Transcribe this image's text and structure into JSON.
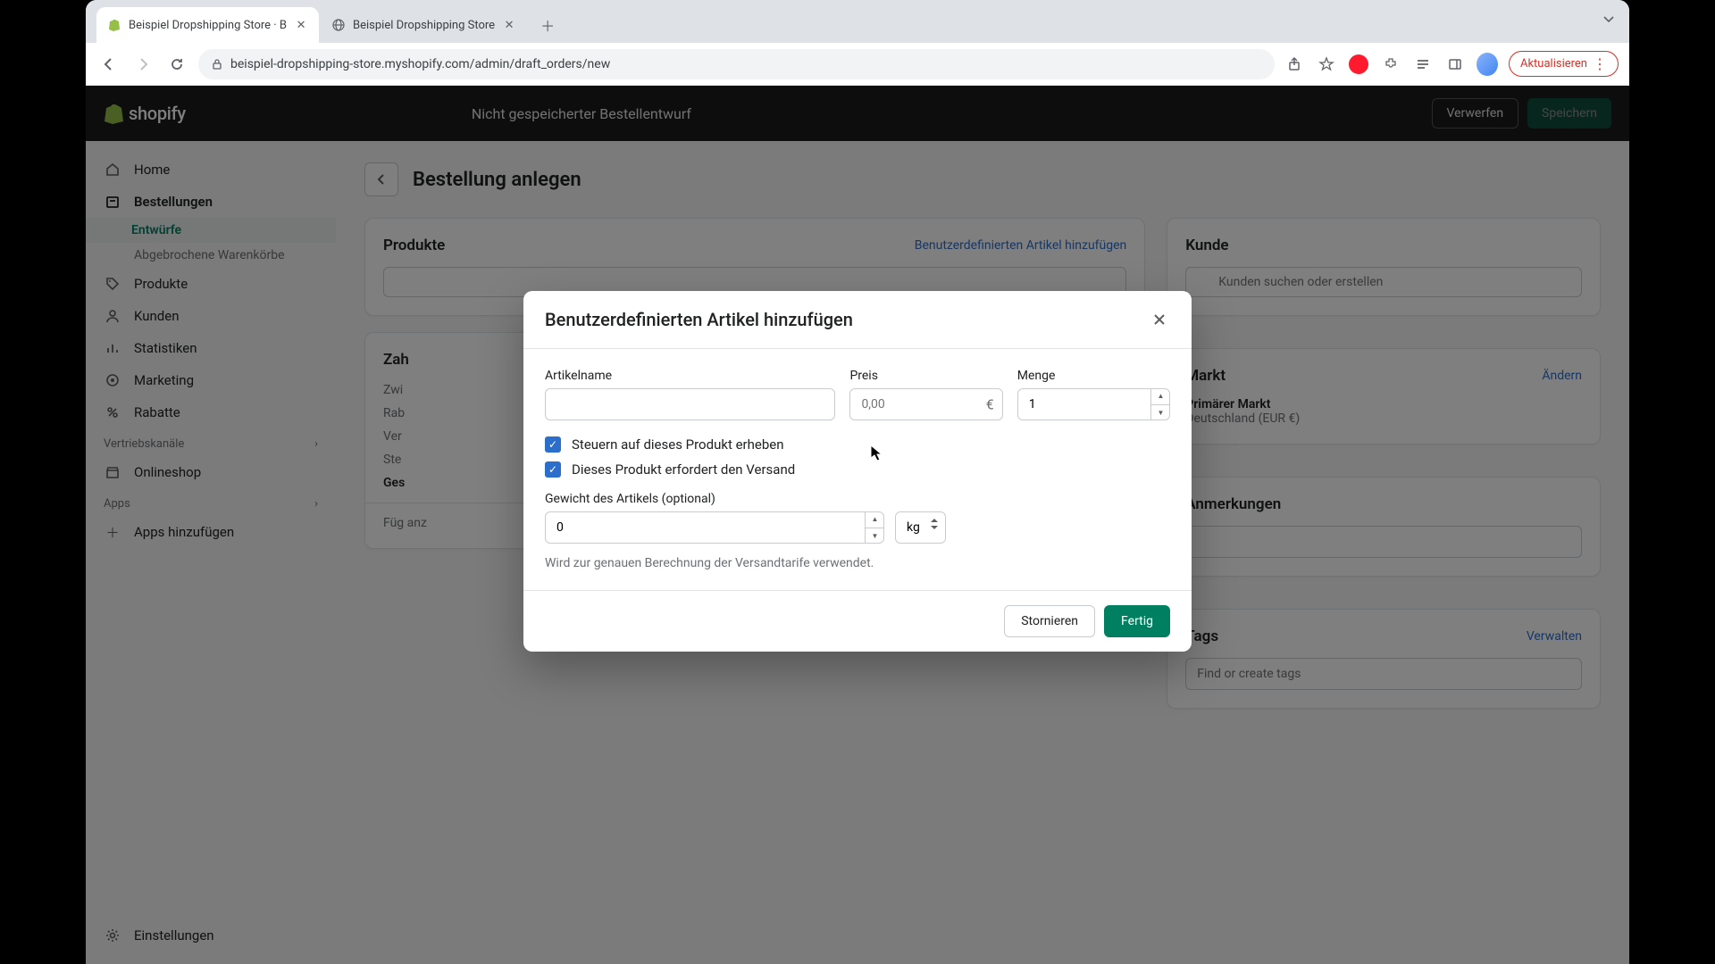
{
  "browser": {
    "tabs": [
      {
        "title": "Beispiel Dropshipping Store · B"
      },
      {
        "title": "Beispiel Dropshipping Store"
      }
    ],
    "url": "beispiel-dropshipping-store.myshopify.com/admin/draft_orders/new",
    "update_label": "Aktualisieren"
  },
  "topbar": {
    "brand": "shopify",
    "message": "Nicht gespeicherter Bestellentwurf",
    "discard": "Verwerfen",
    "save": "Speichern"
  },
  "sidebar": {
    "home": "Home",
    "orders": "Bestellungen",
    "drafts": "Entwürfe",
    "abandoned": "Abgebrochene Warenkörbe",
    "products": "Produkte",
    "customers": "Kunden",
    "analytics": "Statistiken",
    "marketing": "Marketing",
    "discounts": "Rabatte",
    "channels_header": "Vertriebskanäle",
    "onlinestore": "Onlineshop",
    "apps_header": "Apps",
    "add_apps": "Apps hinzufügen",
    "settings": "Einstellungen"
  },
  "page": {
    "title": "Bestellung anlegen",
    "products": {
      "title": "Produkte",
      "link": "Benutzerdefinierten Artikel hinzufügen"
    },
    "payment": {
      "title": "Zah",
      "subtotal": "Zwi",
      "discount": "Rab",
      "shipping": "Ver",
      "tax": "Ste",
      "total": "Ges",
      "note": "Füg anz"
    },
    "customer": {
      "title": "Kunde",
      "placeholder": "Kunden suchen oder erstellen"
    },
    "market": {
      "title": "Markt",
      "change": "Ändern",
      "primary": "Primärer Markt",
      "region": "Deutschland (EUR €)"
    },
    "notes": {
      "title": "Anmerkungen"
    },
    "tags": {
      "title": "Tags",
      "manage": "Verwalten",
      "placeholder": "Find or create tags"
    }
  },
  "modal": {
    "title": "Benutzerdefinierten Artikel hinzufügen",
    "name_label": "Artikelname",
    "price_label": "Preis",
    "price_placeholder": "0,00",
    "price_currency": "€",
    "qty_label": "Menge",
    "qty_value": "1",
    "tax_check": "Steuern auf dieses Produkt erheben",
    "ship_check": "Dieses Produkt erfordert den Versand",
    "weight_label": "Gewicht des Artikels (optional)",
    "weight_value": "0",
    "weight_unit": "kg",
    "weight_help": "Wird zur genauen Berechnung der Versandtarife verwendet.",
    "cancel": "Stornieren",
    "done": "Fertig"
  }
}
